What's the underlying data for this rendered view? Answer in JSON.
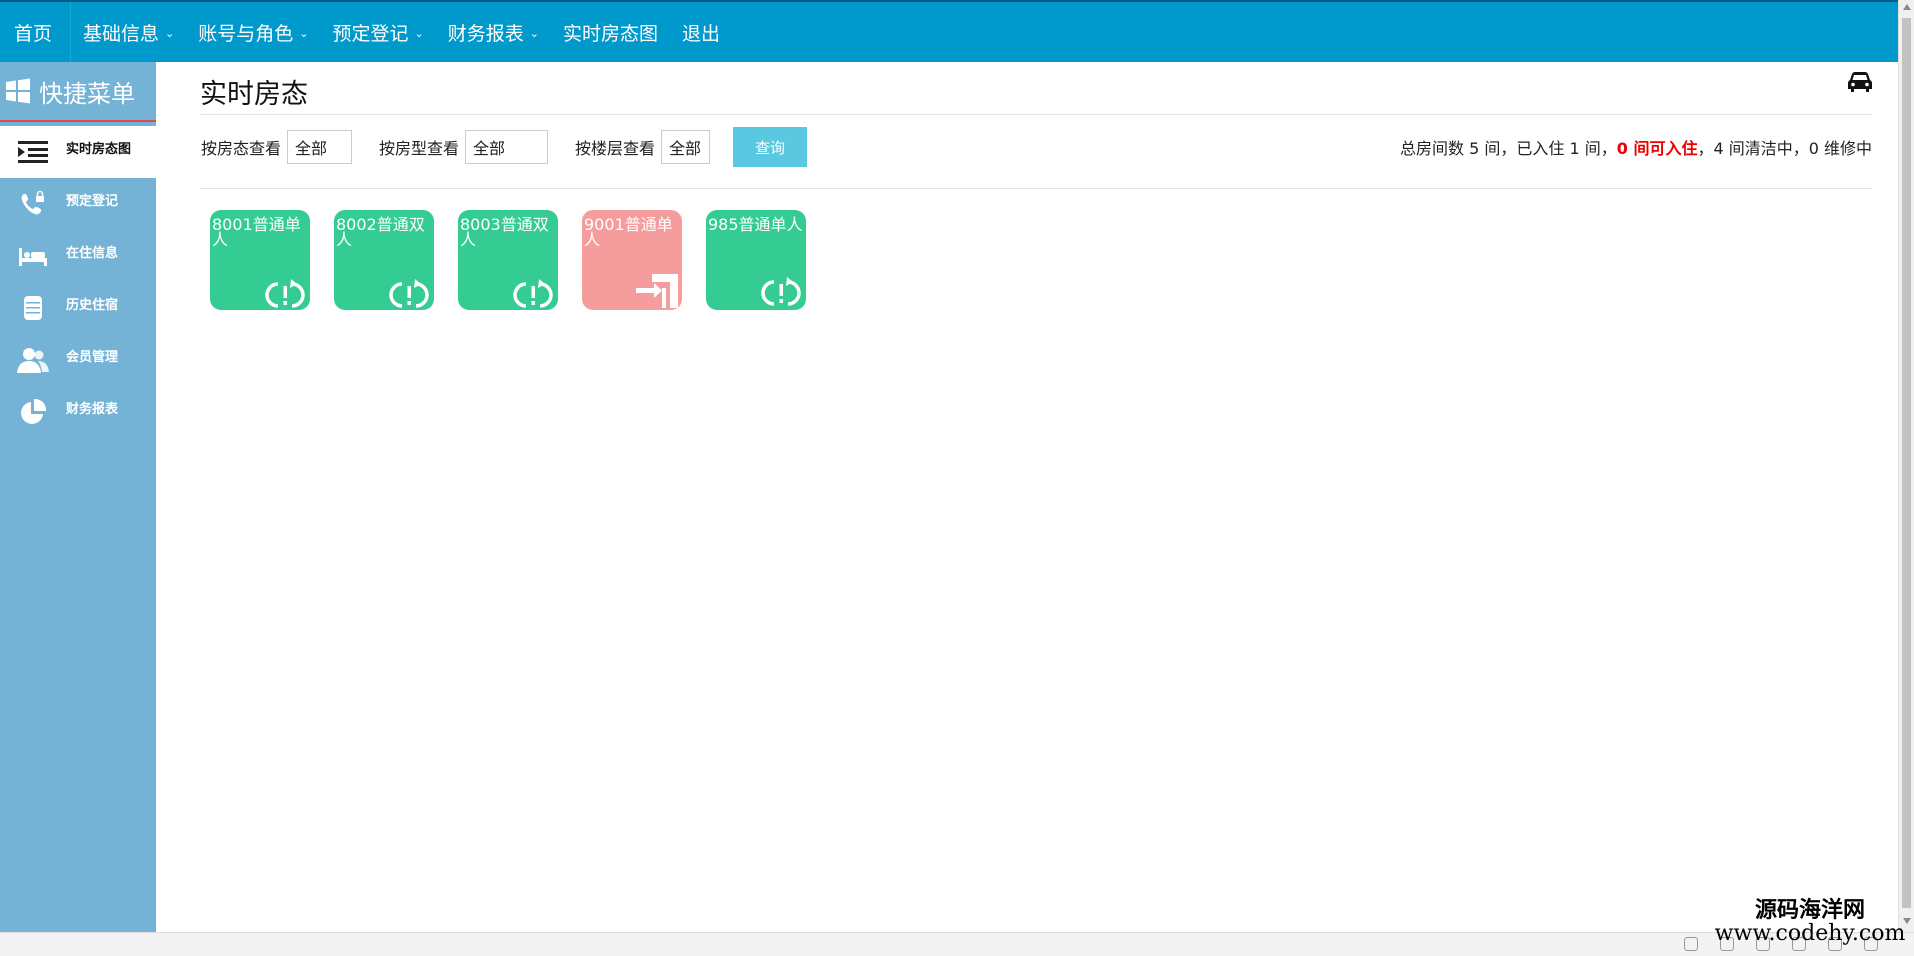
{
  "nav": {
    "home": "首页",
    "items": [
      {
        "label": "基础信息",
        "dropdown": true
      },
      {
        "label": "账号与角色",
        "dropdown": true
      },
      {
        "label": "预定登记",
        "dropdown": true
      },
      {
        "label": "财务报表",
        "dropdown": true
      },
      {
        "label": "实时房态图",
        "dropdown": false
      },
      {
        "label": "退出",
        "dropdown": false
      }
    ],
    "caret": "⌄"
  },
  "sidebar": {
    "title": "快捷菜单",
    "items": [
      {
        "label": "实时房态图",
        "icon": "list-indent-icon",
        "active": true
      },
      {
        "label": "预定登记",
        "icon": "phone-lock-icon",
        "active": false
      },
      {
        "label": "在住信息",
        "icon": "bed-icon",
        "active": false
      },
      {
        "label": "历史住宿",
        "icon": "archive-icon",
        "active": false
      },
      {
        "label": "会员管理",
        "icon": "users-icon",
        "active": false
      },
      {
        "label": "财务报表",
        "icon": "pie-chart-icon",
        "active": false
      }
    ]
  },
  "main": {
    "title": "实时房态",
    "filters": [
      {
        "label": "按房态查看",
        "value": "全部"
      },
      {
        "label": "按房型查看",
        "value": "全部"
      },
      {
        "label": "按楼层查看",
        "value": "全部"
      }
    ],
    "query_button": "查询",
    "summary": {
      "part1": "总房间数 5 间，已入住 1 间，",
      "available": "0 间可入住",
      "part2": "，4 间清洁中，0 维修中"
    },
    "rooms": [
      {
        "label": "8001普通单人",
        "status": "cleaning",
        "color": "#34cc93"
      },
      {
        "label": "8002普通双人",
        "status": "cleaning",
        "color": "#34cc93"
      },
      {
        "label": "8003普通双人",
        "status": "cleaning",
        "color": "#34cc93"
      },
      {
        "label": "9001普通单人",
        "status": "occupied",
        "color": "#f59c9d"
      },
      {
        "label": "985普通单人",
        "status": "cleaning",
        "color": "#34cc93"
      }
    ]
  },
  "watermark": {
    "line1": "源码海洋网",
    "line2": "www.codehy.com"
  },
  "colors": {
    "nav": "#0099cc",
    "sidebar": "#74b3d6",
    "room_clean": "#34cc93",
    "room_occupied": "#f59c9d",
    "query_button": "#5bc8e2"
  }
}
